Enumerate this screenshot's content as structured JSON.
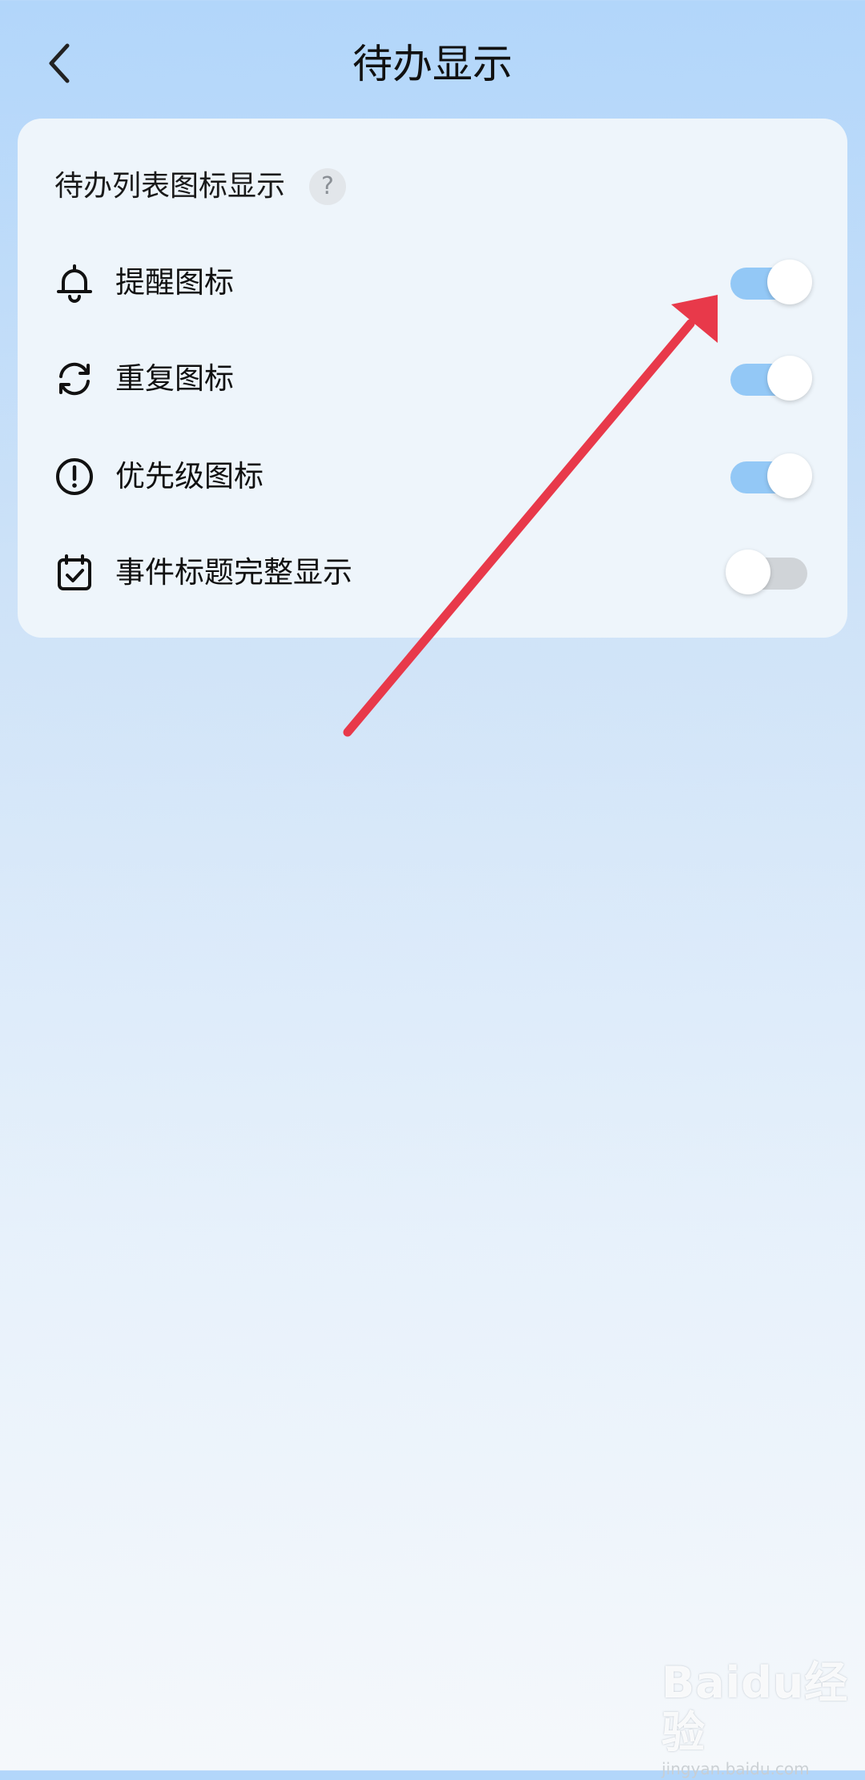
{
  "header": {
    "title": "待办显示",
    "back_icon": "chevron-left-icon"
  },
  "card": {
    "section_title": "待办列表图标显示",
    "help_label": "?",
    "rows": [
      {
        "label": "提醒图标",
        "icon": "bell-icon",
        "enabled": true
      },
      {
        "label": "重复图标",
        "icon": "repeat-icon",
        "enabled": true
      },
      {
        "label": "优先级图标",
        "icon": "exclamation-circle-icon",
        "enabled": true
      },
      {
        "label": "事件标题完整显示",
        "icon": "calendar-check-icon",
        "enabled": false
      }
    ]
  },
  "annotation": {
    "arrow_color": "#e8394a"
  },
  "watermark": {
    "logo": "Baidu经验",
    "url": "jingyan.baidu.com"
  },
  "colors": {
    "toggle_on": "#93c8f6",
    "toggle_off": "#d0d4d8"
  }
}
